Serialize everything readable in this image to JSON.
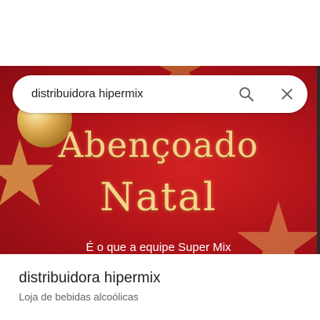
{
  "search": {
    "value": "distribuidora hipermix",
    "search_icon": "search-icon",
    "clear_icon": "close-icon"
  },
  "hero": {
    "title_line1": "Abençoado",
    "title_line2": "Natal",
    "tagline": "É o que a equipe Super Mix"
  },
  "place": {
    "name": "distribuidora hipermix",
    "category": "Loja de bebidas alcoólicas"
  },
  "colors": {
    "hero_red": "#b3141a",
    "gold": "#f6d489",
    "text_primary": "#202124",
    "text_secondary": "#5f6368"
  }
}
